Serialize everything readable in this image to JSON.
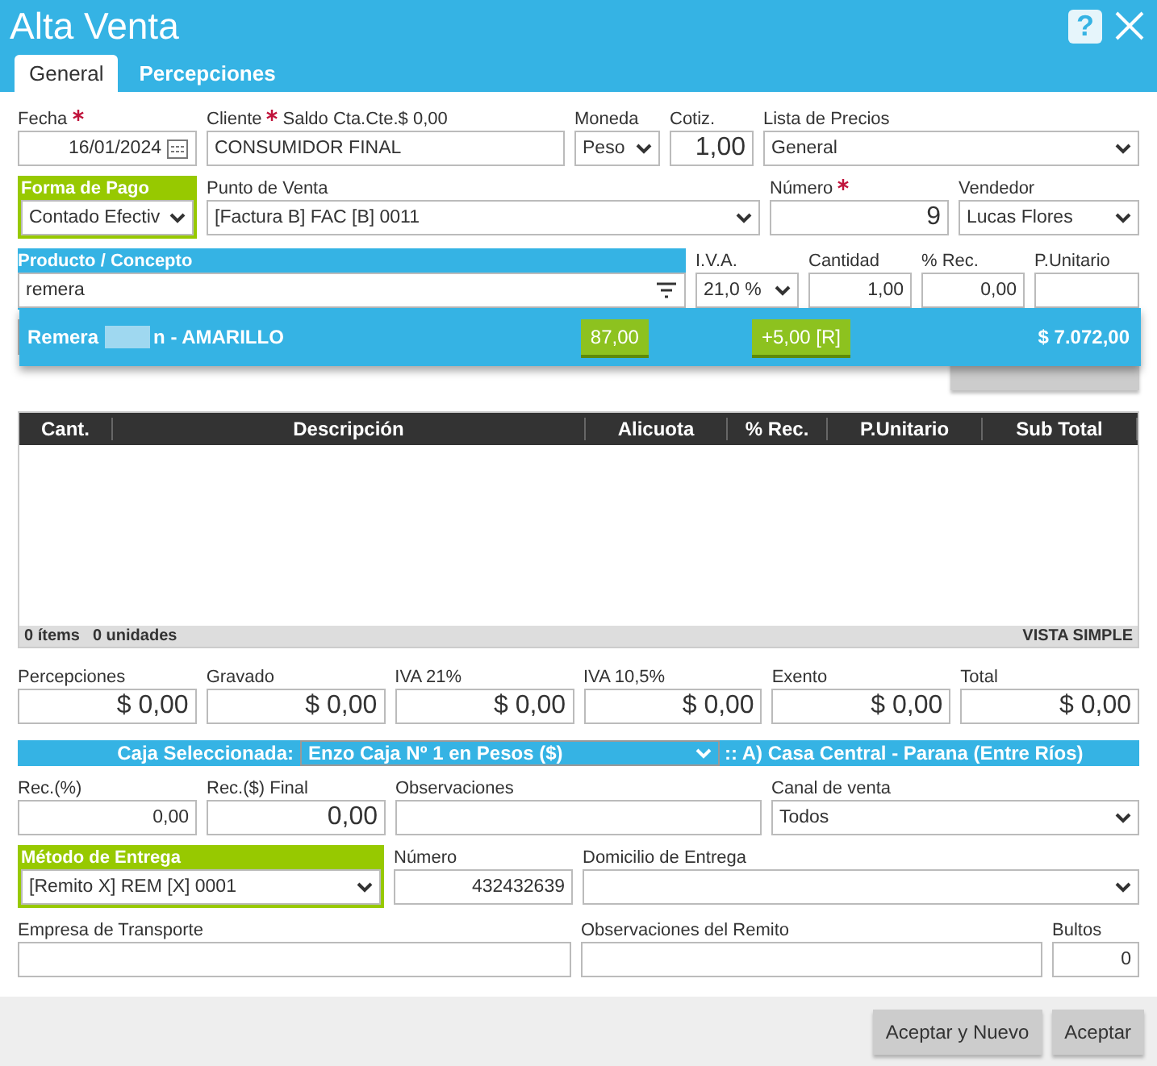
{
  "window": {
    "title": "Alta Venta",
    "help": "?"
  },
  "tabs": [
    {
      "label": "General",
      "selected": true
    },
    {
      "label": "Percepciones",
      "selected": false
    }
  ],
  "rows": [
    [
      {
        "label": "Fecha",
        "required": true,
        "kind": "date",
        "value": "16/01/2024"
      },
      {
        "label": "Cliente",
        "required": true,
        "extra": "Saldo Cta.Cte.$ 0,00",
        "kind": "input",
        "value": "CONSUMIDOR FINAL"
      },
      {
        "label": "Moneda",
        "required": false,
        "kind": "select",
        "value": "Peso"
      },
      {
        "label": "Cotiz.",
        "required": false,
        "kind": "input",
        "value": "1,00"
      },
      {
        "label": "Lista de Precios",
        "required": false,
        "kind": "select",
        "value": "General"
      }
    ],
    [
      {
        "label": "Forma de Pago",
        "required": false,
        "kind": "select",
        "value": "Contado Efectiv"
      },
      {
        "label": "Punto de Venta",
        "required": false,
        "kind": "select",
        "value": "[Factura B] FAC [B] 0011"
      },
      {
        "label": "Número",
        "required": true,
        "kind": "input",
        "value": "9"
      },
      {
        "label": "Vendedor",
        "required": false,
        "kind": "select",
        "value": "Lucas Flores"
      }
    ],
    [
      {
        "label": "Producto / Concepto",
        "required": false,
        "kind": "search",
        "value": "remera"
      },
      {
        "label": "I.V.A.",
        "required": false,
        "kind": "select",
        "value": "21,0 %"
      },
      {
        "label": "Cantidad",
        "required": false,
        "kind": "input",
        "value": "1,00"
      },
      {
        "label": "% Rec.",
        "required": false,
        "kind": "input",
        "value": "0,00"
      },
      {
        "label": "P.Unitario",
        "required": false,
        "kind": "input"
      }
    ]
  ],
  "suggestion": {
    "name_start": "Remera",
    "name_end": "n - AMARILLO",
    "stock": "87,00",
    "extra": "+5,00 [R]",
    "price": "$ 7.072,00"
  },
  "table": {
    "columns": [
      "Cant.",
      "Descripción",
      "Alicuota",
      "% Rec.",
      "P.Unitario",
      "Sub Total"
    ],
    "footer_items": "0 ítems",
    "footer_units": "0 unidades",
    "view": "VISTA SIMPLE"
  },
  "totals": [
    {
      "label": "Percepciones",
      "value": "$ 0,00"
    },
    {
      "label": "Gravado",
      "value": "$ 0,00"
    },
    {
      "label": "IVA 21%",
      "value": "$ 0,00"
    },
    {
      "label": "IVA 10,5%",
      "value": "$ 0,00"
    },
    {
      "label": "Exento",
      "value": "$ 0,00"
    },
    {
      "label": "Total",
      "value": "$ 0,00"
    }
  ],
  "caja": {
    "label": "Caja Seleccionada:",
    "value": "Enzo Caja Nº 1 en Pesos ($)",
    "branch": ":: A) Casa Central - Parana (Entre Ríos)"
  },
  "rows2": [
    [
      {
        "label": "Rec.(%)",
        "kind": "input",
        "value": "0,00"
      },
      {
        "label": "Rec.($) Final",
        "kind": "input",
        "value": "0,00"
      },
      {
        "label": "Observaciones",
        "kind": "input"
      },
      {
        "label": "Canal de venta",
        "kind": "select",
        "value": "Todos"
      }
    ],
    [
      {
        "label": "Método de Entrega",
        "kind": "select",
        "value": "[Remito X] REM [X] 0001"
      },
      {
        "label": "Número",
        "kind": "input",
        "value": "432432639"
      },
      {
        "label": "Domicilio de Entrega",
        "kind": "select"
      }
    ],
    [
      {
        "label": "Empresa de Transporte",
        "kind": "input"
      },
      {
        "label": "Observaciones del Remito",
        "kind": "input"
      },
      {
        "label": "Bultos",
        "kind": "input",
        "value": "0"
      }
    ]
  ],
  "buttons": [
    "Aceptar y Nuevo",
    "Aceptar"
  ]
}
